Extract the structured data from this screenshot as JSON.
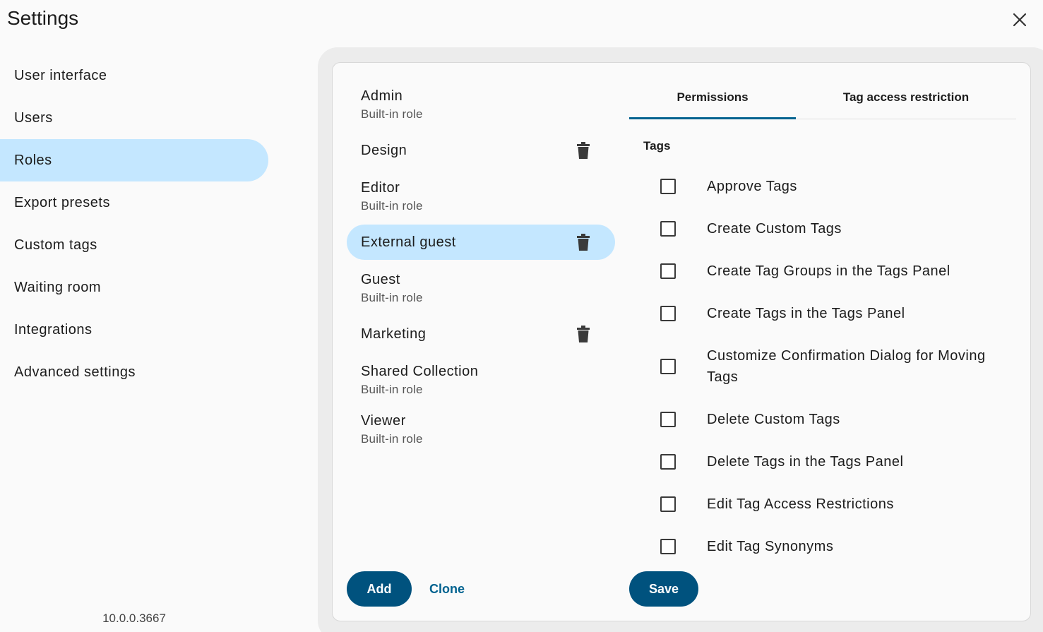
{
  "header": {
    "title": "Settings"
  },
  "nav": {
    "items": [
      {
        "label": "User interface",
        "active": false
      },
      {
        "label": "Users",
        "active": false
      },
      {
        "label": "Roles",
        "active": true
      },
      {
        "label": "Export presets",
        "active": false
      },
      {
        "label": "Custom tags",
        "active": false
      },
      {
        "label": "Waiting room",
        "active": false
      },
      {
        "label": "Integrations",
        "active": false
      },
      {
        "label": "Advanced settings",
        "active": false
      }
    ]
  },
  "version": "10.0.0.3667",
  "roles": [
    {
      "name": "Admin",
      "subtitle": "Built-in role"
    },
    {
      "name": "Design",
      "subtitle": null,
      "deletable": true
    },
    {
      "name": "Editor",
      "subtitle": "Built-in role"
    },
    {
      "name": "External guest",
      "subtitle": null,
      "deletable": true,
      "active": true
    },
    {
      "name": "Guest",
      "subtitle": "Built-in role"
    },
    {
      "name": "Marketing",
      "subtitle": null,
      "deletable": true
    },
    {
      "name": "Shared Collection",
      "subtitle": "Built-in role"
    },
    {
      "name": "Viewer",
      "subtitle": "Built-in role"
    }
  ],
  "actions": {
    "add_label": "Add",
    "clone_label": "Clone",
    "save_label": "Save"
  },
  "tabs": [
    {
      "label": "Permissions",
      "active": true
    },
    {
      "label": "Tag access restriction",
      "active": false
    }
  ],
  "permissions": {
    "group_label": "Tags",
    "items": [
      {
        "label": "Approve Tags",
        "checked": false
      },
      {
        "label": "Create Custom Tags",
        "checked": false
      },
      {
        "label": "Create Tag Groups in the Tags Panel",
        "checked": false
      },
      {
        "label": "Create Tags in the Tags Panel",
        "checked": false
      },
      {
        "label": "Customize Confirmation Dialog for Moving Tags",
        "checked": false
      },
      {
        "label": "Delete Custom Tags",
        "checked": false
      },
      {
        "label": "Delete Tags in the Tags Panel",
        "checked": false
      },
      {
        "label": "Edit Tag Access Restrictions",
        "checked": false
      },
      {
        "label": "Edit Tag Synonyms",
        "checked": false
      }
    ]
  },
  "colors": {
    "accent": "#00527e",
    "selection": "#c4e7ff",
    "link": "#00628f"
  }
}
